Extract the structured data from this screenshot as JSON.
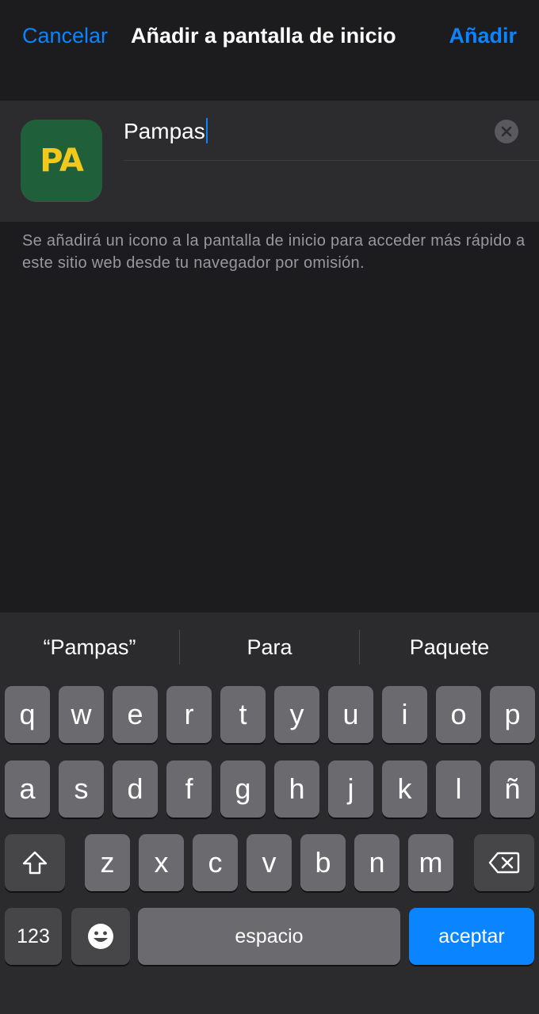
{
  "nav": {
    "cancel_label": "Cancelar",
    "title": "Añadir a pantalla de inicio",
    "add_label": "Añadir"
  },
  "app": {
    "icon_text": "PA",
    "icon_bg": "#1f5f3a",
    "icon_fg": "#f2c81b",
    "name_value": "Pampas"
  },
  "help_text": "Se añadirá un icono a la pantalla de inicio para acceder más rápido a este sitio web desde tu navegador por omisión.",
  "keyboard": {
    "suggestions": [
      "“Pampas”",
      "Para",
      "Paquete"
    ],
    "row1": [
      "q",
      "w",
      "e",
      "r",
      "t",
      "y",
      "u",
      "i",
      "o",
      "p"
    ],
    "row2": [
      "a",
      "s",
      "d",
      "f",
      "g",
      "h",
      "j",
      "k",
      "l",
      "ñ"
    ],
    "row3": [
      "z",
      "x",
      "c",
      "v",
      "b",
      "n",
      "m"
    ],
    "numbers_label": "123",
    "space_label": "espacio",
    "return_label": "aceptar",
    "accent_color": "#0a84ff"
  }
}
